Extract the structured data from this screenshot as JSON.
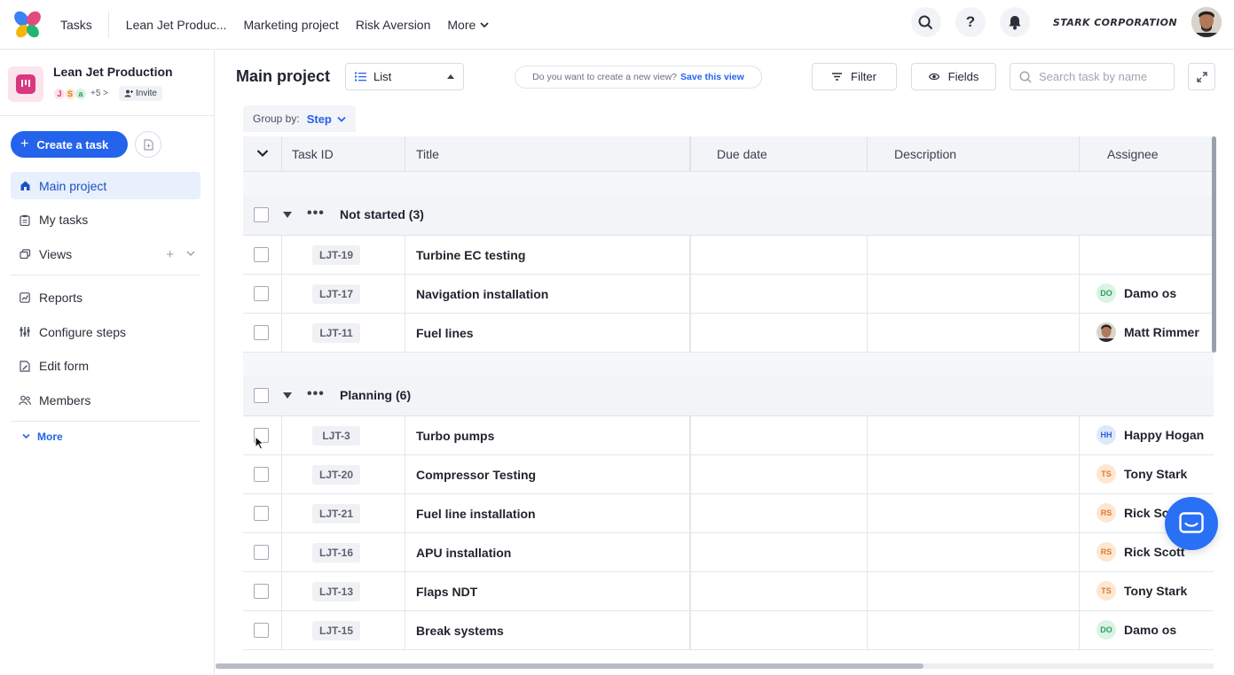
{
  "topbar": {
    "app_label": "Tasks",
    "nav": [
      "Lean Jet Produc...",
      "Marketing project",
      "Risk Aversion"
    ],
    "more_label": "More",
    "brand": "STARK CORPORATION"
  },
  "sidebar": {
    "project_name": "Lean Jet Production",
    "members": [
      "J",
      "S",
      "a"
    ],
    "more_members": "+5 >",
    "invite_label": "Invite",
    "create_label": "Create a task",
    "items": [
      {
        "label": "Main project",
        "icon": "home-icon",
        "active": true
      },
      {
        "label": "My tasks",
        "icon": "clipboard-icon"
      },
      {
        "label": "Views",
        "icon": "layers-icon"
      },
      {
        "label": "Reports",
        "icon": "chart-icon"
      },
      {
        "label": "Configure steps",
        "icon": "steps-icon"
      },
      {
        "label": "Edit form",
        "icon": "form-icon"
      },
      {
        "label": "Members",
        "icon": "members-icon"
      }
    ],
    "more_label": "More"
  },
  "main": {
    "title": "Main project",
    "view_select": "List",
    "save_prompt": "Do you want to create a new view?",
    "save_link": "Save this view",
    "filter_label": "Filter",
    "fields_label": "Fields",
    "search_placeholder": "Search task by name",
    "group_by_label": "Group by:",
    "group_by_value": "Step"
  },
  "table": {
    "columns": [
      "Task ID",
      "Title",
      "Due date",
      "Description",
      "Assignee"
    ],
    "groups": [
      {
        "label": "Not started (3)",
        "rows": [
          {
            "id": "LJT-19",
            "title": "Turbine EC testing",
            "assignee": "",
            "initials": "",
            "color": ""
          },
          {
            "id": "LJT-17",
            "title": "Navigation installation",
            "assignee": "Damo os",
            "initials": "DO",
            "color": "#2f9e5b"
          },
          {
            "id": "LJT-11",
            "title": "Fuel lines",
            "assignee": "Matt Rimmer",
            "initials": "",
            "color": "photo"
          }
        ]
      },
      {
        "label": "Planning (6)",
        "rows": [
          {
            "id": "LJT-3",
            "title": "Turbo pumps",
            "assignee": "Happy Hogan",
            "initials": "HH",
            "color": "#2d63d6"
          },
          {
            "id": "LJT-20",
            "title": "Compressor Testing",
            "assignee": "Tony Stark",
            "initials": "TS",
            "color": "#e07a2d"
          },
          {
            "id": "LJT-21",
            "title": "Fuel line installation",
            "assignee": "Rick Sc",
            "initials": "RS",
            "color": "#e07a2d"
          },
          {
            "id": "LJT-16",
            "title": "APU installation",
            "assignee": "Rick Scott",
            "initials": "RS",
            "color": "#e07a2d"
          },
          {
            "id": "LJT-13",
            "title": "Flaps NDT",
            "assignee": "Tony Stark",
            "initials": "TS",
            "color": "#e07a2d"
          },
          {
            "id": "LJT-15",
            "title": "Break systems",
            "assignee": "Damo os",
            "initials": "DO",
            "color": "#2f9e5b"
          }
        ]
      }
    ]
  }
}
